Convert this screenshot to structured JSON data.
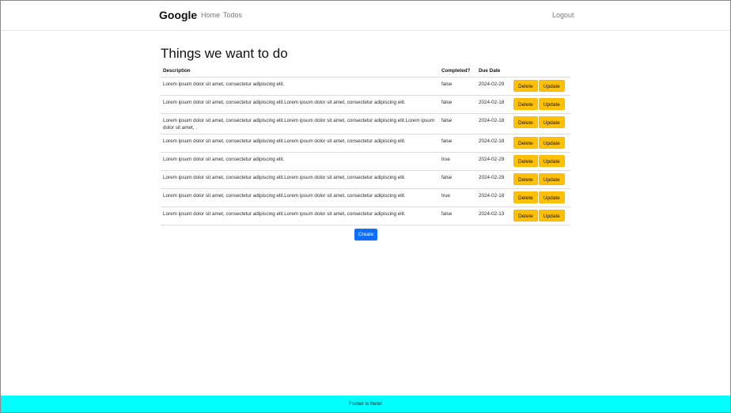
{
  "navbar": {
    "brand": "Google",
    "links": {
      "home": "Home",
      "todos": "Todos",
      "logout": "Logout"
    }
  },
  "main": {
    "title": "Things we want to do",
    "columns": {
      "description": "Description",
      "completed": "Completed?",
      "due_date": "Due Date"
    },
    "rows": [
      {
        "description": "Lorem ipsum dolor sit amet, consectetur adipiscing elit.",
        "completed": "false",
        "due_date": "2024-02-29"
      },
      {
        "description": "Lorem ipsum dolor sit amet, consectetur adipiscing elit.Lorem ipsum dolor sit amet, consectetur adipiscing elit.",
        "completed": "false",
        "due_date": "2024-02-18"
      },
      {
        "description": "Lorem ipsum dolor sit amet, consectetur adipiscing elit.Lorem ipsum dolor sit amet, consectetur adipiscing elit.Lorem ipsum dolor sit amet, .",
        "completed": "false",
        "due_date": "2024-02-18"
      },
      {
        "description": "Lorem ipsum dolor sit amet, consectetur adipiscing elit.Lorem ipsum dolor sit amet, consectetur adipiscing elit.",
        "completed": "false",
        "due_date": "2024-02-18"
      },
      {
        "description": "Lorem ipsum dolor sit amet, consectetur adipiscing elit.",
        "completed": "true",
        "due_date": "2024-02-29"
      },
      {
        "description": "Lorem ipsum dolor sit amet, consectetur adipiscing elit.Lorem ipsum dolor sit amet, consectetur adipiscing elit.",
        "completed": "false",
        "due_date": "2024-02-29"
      },
      {
        "description": "Lorem ipsum dolor sit amet, consectetur adipiscing elit.Lorem ipsum dolor sit amet, consectetur adipiscing elit.",
        "completed": "true",
        "due_date": "2024-02-18"
      },
      {
        "description": "Lorem ipsum dolor sit amet, consectetur adipiscing elit.Lorem ipsum dolor sit amet, consectetur adipiscing elit.",
        "completed": "false",
        "due_date": "2024-02-13"
      }
    ],
    "buttons": {
      "delete": "Delete",
      "update": "Update",
      "create": "Create"
    }
  },
  "footer": {
    "text": "Footer is here!"
  },
  "colors": {
    "warning": "#ffc107",
    "primary": "#0d6efd",
    "footer_bg": "#00ffff"
  }
}
